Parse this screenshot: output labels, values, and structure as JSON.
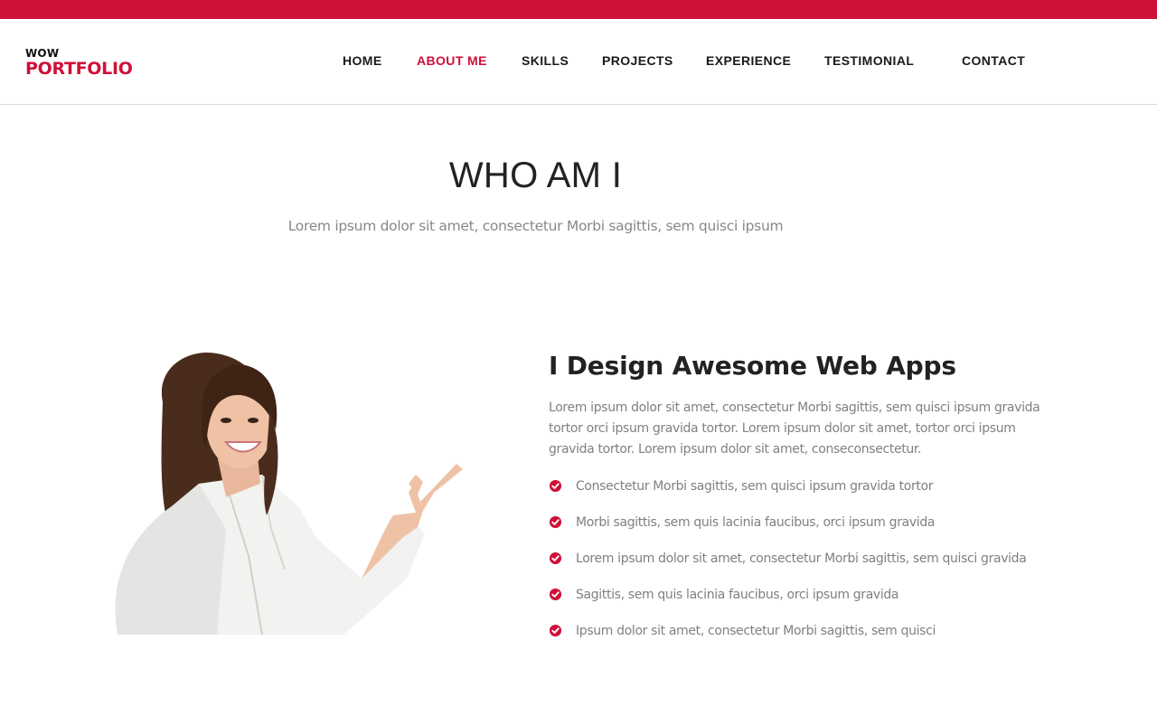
{
  "logo": {
    "top": "WOW",
    "main": "PORTFOLIO"
  },
  "nav": {
    "items": [
      {
        "label": "HOME"
      },
      {
        "label": "ABOUT ME",
        "active": true
      },
      {
        "label": "SKILLS"
      },
      {
        "label": "PROJECTS"
      },
      {
        "label": "EXPERIENCE"
      },
      {
        "label": "TESTIMONIAL"
      },
      {
        "label": "CONTACT"
      }
    ]
  },
  "section": {
    "title": "WHO AM I",
    "subtitle": "Lorem ipsum dolor sit amet, consectetur Morbi sagittis, sem quisci ipsum"
  },
  "about": {
    "heading": "I Design Awesome Web Apps",
    "text": "Lorem ipsum dolor sit amet, consectetur Morbi sagittis, sem quisci ipsum gravida tortor orci ipsum gravida tortor. Lorem ipsum dolor sit amet, tortor orci ipsum gravida tortor. Lorem ipsum dolor sit amet, conseconsectetur.",
    "features": [
      "Consectetur Morbi sagittis, sem quisci ipsum gravida tortor",
      "Morbi sagittis, sem quis lacinia faucibus, orci ipsum gravida",
      "Lorem ipsum dolor sit amet, consectetur Morbi sagittis, sem quisci gravida",
      "Sagittis, sem quis lacinia faucibus, orci ipsum gravida",
      "Ipsum dolor sit amet, consectetur Morbi sagittis, sem quisci"
    ]
  },
  "icons": {
    "feature": "check-circle-icon"
  },
  "colors": {
    "accent": "#cf1038",
    "text": "#222222",
    "muted": "#808080"
  }
}
